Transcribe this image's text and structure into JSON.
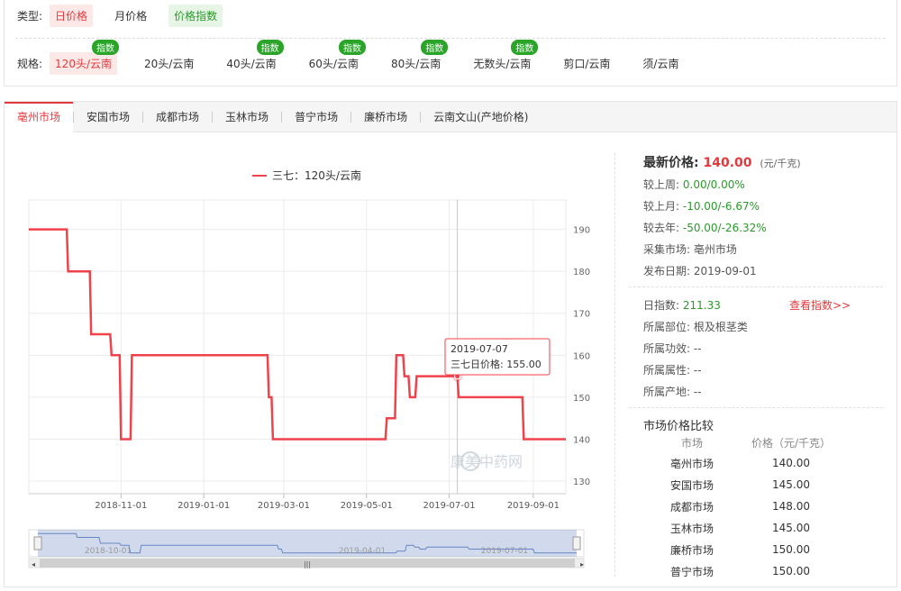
{
  "filters": {
    "type_label": "类型:",
    "types": [
      "日价格",
      "月价格",
      "价格指数"
    ],
    "spec_label": "规格:",
    "specs": [
      "120头/云南",
      "20头/云南",
      "40头/云南",
      "60头/云南",
      "80头/云南",
      "无数头/云南",
      "剪口/云南",
      "须/云南"
    ],
    "badge": "指数"
  },
  "tabs": [
    "亳州市场",
    "安国市场",
    "成都市场",
    "玉林市场",
    "普宁市场",
    "廉桥市场",
    "云南文山(产地价格)"
  ],
  "chart_data": {
    "type": "line",
    "title": "三七：120头/云南",
    "series": [
      {
        "name": "三七：120头/云南",
        "color": "#f0424a"
      }
    ],
    "ylim": [
      127,
      197
    ],
    "yticks": [
      130,
      140,
      150,
      160,
      170,
      180,
      190
    ],
    "xticks": [
      "2018-11-01",
      "2019-01-01",
      "2019-03-01",
      "2019-05-01",
      "2019-07-01",
      "2019-09-01"
    ],
    "x_range": [
      "2018-08-25",
      "2019-09-25"
    ],
    "points": [
      [
        "2018-08-25",
        190
      ],
      [
        "2018-09-22",
        190
      ],
      [
        "2018-09-23",
        180
      ],
      [
        "2018-10-09",
        180
      ],
      [
        "2018-10-10",
        165
      ],
      [
        "2018-10-24",
        165
      ],
      [
        "2018-10-25",
        160
      ],
      [
        "2018-10-31",
        160
      ],
      [
        "2018-11-01",
        140
      ],
      [
        "2018-11-08",
        140
      ],
      [
        "2018-11-09",
        160
      ],
      [
        "2019-02-17",
        160
      ],
      [
        "2019-02-18",
        150
      ],
      [
        "2019-02-20",
        150
      ],
      [
        "2019-02-21",
        140
      ],
      [
        "2019-05-15",
        140
      ],
      [
        "2019-05-16",
        145
      ],
      [
        "2019-05-22",
        145
      ],
      [
        "2019-05-23",
        160
      ],
      [
        "2019-05-28",
        160
      ],
      [
        "2019-05-29",
        155
      ],
      [
        "2019-06-01",
        155
      ],
      [
        "2019-06-02",
        150
      ],
      [
        "2019-06-06",
        150
      ],
      [
        "2019-06-07",
        155
      ],
      [
        "2019-07-07",
        155
      ],
      [
        "2019-07-08",
        150
      ],
      [
        "2019-08-24",
        150
      ],
      [
        "2019-08-25",
        140
      ],
      [
        "2019-09-25",
        140
      ]
    ],
    "tooltip": {
      "date": "2019-07-07",
      "label": "三七日价格:",
      "value": "155.00"
    },
    "navigator_labels": [
      "2018-10-01",
      "2019-04-01",
      "2019-07-01"
    ],
    "watermark": "康美中药网"
  },
  "info": {
    "latest_label": "最新价格:",
    "latest_value": "140.00",
    "unit": "(元/千克)",
    "week_label": "较上周:",
    "week_value": "0.00/0.00%",
    "month_label": "较上月:",
    "month_value": "-10.00/-6.67%",
    "year_label": "较去年:",
    "year_value": "-50.00/-26.32%",
    "market_label": "采集市场:",
    "market_value": "亳州市场",
    "date_label": "发布日期:",
    "date_value": "2019-09-01",
    "index_label": "日指数:",
    "index_value": "211.33",
    "index_link": "查看指数>>",
    "part_label": "所属部位:",
    "part_value": "根及根茎类",
    "effect_label": "所属功效:",
    "effect_value": "--",
    "attr_label": "所属属性:",
    "attr_value": "--",
    "origin_label": "所属产地:",
    "origin_value": "--"
  },
  "compare": {
    "title": "市场价格比较",
    "col_market": "市场",
    "col_price": "价格（元/千克）",
    "rows": [
      {
        "market": "亳州市场",
        "price": "140.00"
      },
      {
        "market": "安国市场",
        "price": "145.00"
      },
      {
        "market": "成都市场",
        "price": "148.00"
      },
      {
        "market": "玉林市场",
        "price": "145.00"
      },
      {
        "market": "廉桥市场",
        "price": "150.00"
      },
      {
        "market": "普宁市场",
        "price": "150.00"
      }
    ]
  }
}
